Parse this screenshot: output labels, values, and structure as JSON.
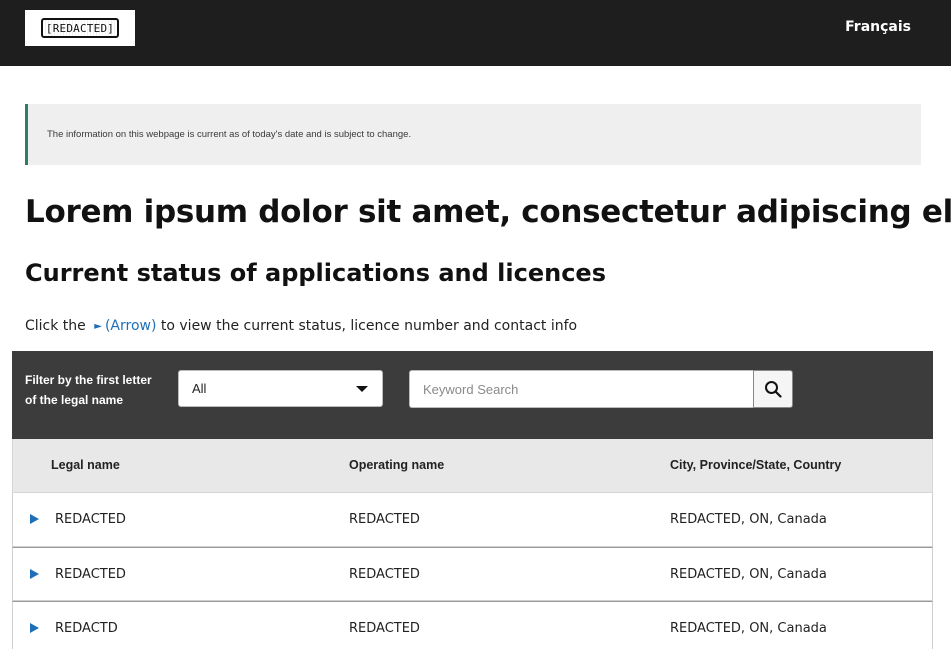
{
  "header": {
    "logo_text": "[REDACTED]",
    "language_link": "Français"
  },
  "notice": {
    "text": "The information on this webpage is current as of today's date and is subject to change."
  },
  "page_title": "Lorem ipsum dolor sit amet, consectetur adipiscing elit.",
  "section_title": "Current status of applications and licences",
  "instruction": {
    "prefix": "Click the",
    "arrow_glyph": "►",
    "link_text": "(Arrow)",
    "suffix": "to view the current status, licence number and contact info"
  },
  "filter": {
    "label": "Filter by the first letter of the legal name",
    "selected_letter": "All",
    "search_placeholder": "Keyword Search"
  },
  "table": {
    "columns": [
      "Legal name",
      "Operating name",
      "City, Province/State, Country"
    ],
    "rows": [
      {
        "legal_name": "REDACTED",
        "operating_name": "REDACTED",
        "location": "REDACTED, ON, Canada"
      },
      {
        "legal_name": "REDACTED",
        "operating_name": "REDACTED",
        "location": "REDACTED, ON, Canada"
      },
      {
        "legal_name": "REDACTD",
        "operating_name": "REDACTED",
        "location": "REDACTED, ON, Canada"
      }
    ]
  },
  "colors": {
    "topbar": "#1e1e1e",
    "notice_accent": "#2e7d6b",
    "link": "#1f6fb8",
    "filterbar": "#3c3c3c"
  }
}
